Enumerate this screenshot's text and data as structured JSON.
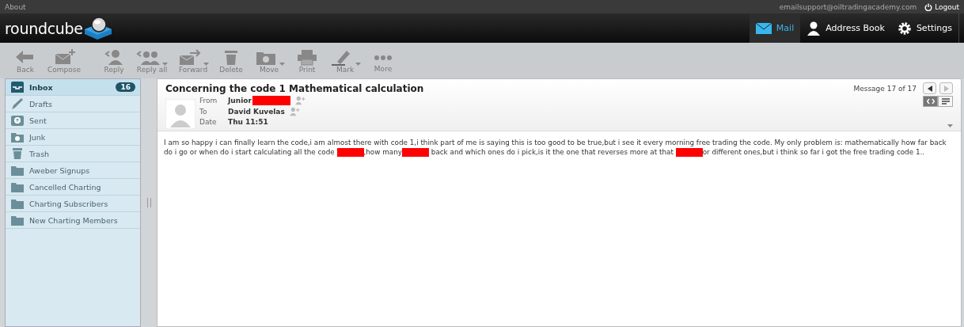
{
  "top_bar": {
    "about": "About",
    "user": "emailsupport@oiltradingacademy.com",
    "logout": "Logout"
  },
  "logo": "roundcube",
  "nav": [
    {
      "label": "Mail",
      "kind": "mail",
      "selected": true
    },
    {
      "label": "Address Book",
      "kind": "person",
      "selected": false
    },
    {
      "label": "Settings",
      "kind": "gear",
      "selected": false
    }
  ],
  "toolbar": [
    {
      "label": "Back",
      "kind": "back",
      "dropdown": false
    },
    {
      "label": "Compose",
      "kind": "compose",
      "dropdown": false
    },
    {
      "label": "Reply",
      "kind": "reply",
      "dropdown": false
    },
    {
      "label": "Reply all",
      "kind": "replyall",
      "dropdown": true
    },
    {
      "label": "Forward",
      "kind": "forward",
      "dropdown": true
    },
    {
      "label": "Delete",
      "kind": "delete",
      "dropdown": false
    },
    {
      "label": "Move",
      "kind": "move",
      "dropdown": true
    },
    {
      "label": "Print",
      "kind": "print",
      "dropdown": false
    },
    {
      "label": "Mark",
      "kind": "mark",
      "dropdown": true
    },
    {
      "label": "More",
      "kind": "more",
      "dropdown": false
    }
  ],
  "folders": [
    {
      "name": "Inbox",
      "kind": "inbox",
      "selected": true,
      "unread": "16"
    },
    {
      "name": "Drafts",
      "kind": "drafts",
      "selected": false
    },
    {
      "name": "Sent",
      "kind": "sent",
      "selected": false
    },
    {
      "name": "Junk",
      "kind": "junk",
      "selected": false
    },
    {
      "name": "Trash",
      "kind": "trash",
      "selected": false
    },
    {
      "name": "Aweber Signups",
      "kind": "folder",
      "selected": false
    },
    {
      "name": "Cancelled Charting",
      "kind": "folder",
      "selected": false
    },
    {
      "name": "Charting Subscribers",
      "kind": "folder",
      "selected": false
    },
    {
      "name": "New Charting Members",
      "kind": "folder",
      "selected": false
    }
  ],
  "message": {
    "subject": "Concerning the code 1 Mathematical calculation",
    "counter": "Message 17 of 17",
    "has_next": false,
    "has_prev": true,
    "view_modes": [
      {
        "kind": "html",
        "selected": true
      },
      {
        "kind": "plain",
        "selected": false
      }
    ],
    "headers": [
      {
        "label": "From",
        "value": "Junior",
        "redacted": true,
        "add_contact": true
      },
      {
        "label": "To",
        "value": "David Kuvelas",
        "redacted": false,
        "add_contact": true
      },
      {
        "label": "Date",
        "value": "Thu 11:51",
        "redacted": false,
        "add_contact": false
      }
    ],
    "body": [
      {
        "kind": "text",
        "text": "I am so happy i can finally learn the code,i am almost there with code 1,i think part of me is saying this is too good to be true,but i see it every morning free trading the code. My only problem is: mathematically how far back do i go or when do i start calculating all the code "
      },
      {
        "kind": "redacted"
      },
      {
        "kind": "text",
        "text": ",how many"
      },
      {
        "kind": "redacted"
      },
      {
        "kind": "text",
        "text": " back and which ones do i pick,is it the one that reverses more at that "
      },
      {
        "kind": "redacted"
      },
      {
        "kind": "text",
        "text": "or different ones,but i think so far i got the free trading code 1.."
      }
    ]
  }
}
